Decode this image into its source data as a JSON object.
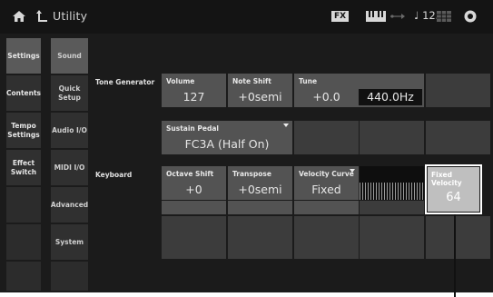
{
  "header": {
    "title": "Utility",
    "fx_badge": "FX",
    "tempo": "125",
    "tempo_icon": "quarter-note-icon"
  },
  "nav": {
    "main": [
      "Settings",
      "Contents",
      "Tempo Settings",
      "Effect Switch"
    ],
    "sub": [
      "Sound",
      "Quick Setup",
      "Audio I/O",
      "MIDI I/O",
      "Advanced",
      "System"
    ]
  },
  "rows": {
    "tone_generator": "Tone Generator",
    "keyboard": "Keyboard"
  },
  "params": {
    "volume": {
      "label": "Volume",
      "value": "127"
    },
    "note_shift": {
      "label": "Note Shift",
      "value": "+0semi"
    },
    "tune": {
      "label": "Tune",
      "value": "+0.0",
      "hz": "440.0Hz"
    },
    "sustain_pedal": {
      "label": "Sustain Pedal",
      "value": "FC3A (Half On)"
    },
    "octave_shift": {
      "label": "Octave Shift",
      "value": "+0"
    },
    "transpose": {
      "label": "Transpose",
      "value": "+0semi"
    },
    "velocity_curve": {
      "label": "Velocity Curve",
      "value": "Fixed"
    },
    "fixed_velocity": {
      "label": "Fixed Velocity",
      "value": "64"
    }
  }
}
